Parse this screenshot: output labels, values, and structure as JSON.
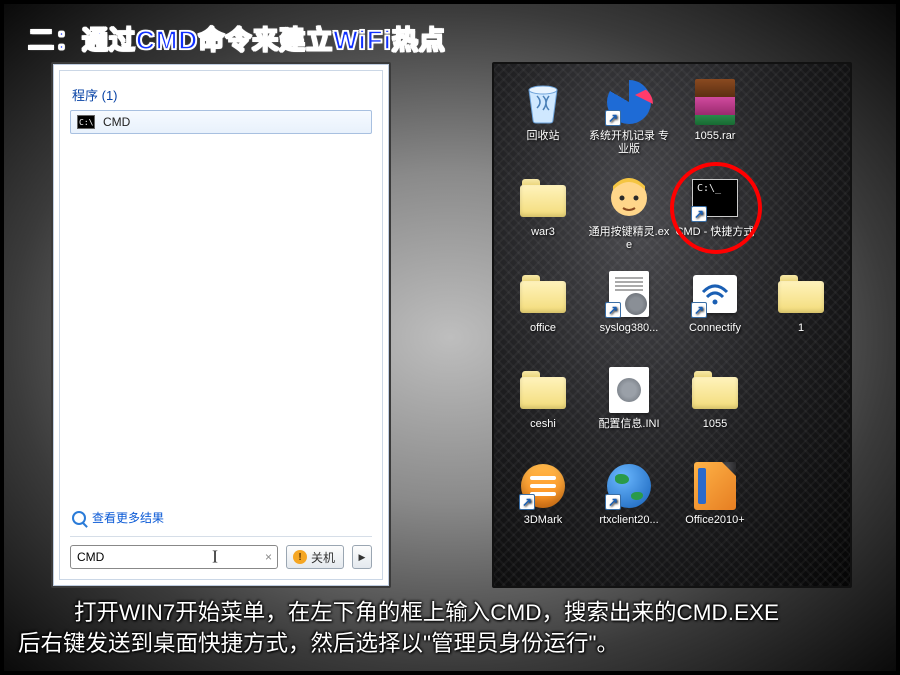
{
  "title": "二：通过CMD命令来建立WiFi热点",
  "start_menu": {
    "programs_header": "程序 (1)",
    "program_item": {
      "label": "CMD"
    },
    "more_results": "查看更多结果",
    "search_value": "CMD",
    "shutdown_label": "关机"
  },
  "desktop": {
    "icons": [
      {
        "id": "recycle-bin",
        "label": "回收站",
        "shortcut": false
      },
      {
        "id": "boot-recorder",
        "label": "系统开机记录 专业版",
        "shortcut": true
      },
      {
        "id": "rar-file",
        "label": "1055.rar",
        "shortcut": false
      },
      null,
      {
        "id": "war3-folder",
        "label": "war3",
        "shortcut": false
      },
      {
        "id": "keypress-wizard",
        "label": "通用按键精灵.exe",
        "shortcut": false
      },
      {
        "id": "cmd-shortcut",
        "label": "CMD - 快捷方式",
        "shortcut": true
      },
      null,
      {
        "id": "office-folder",
        "label": "office",
        "shortcut": false
      },
      {
        "id": "syslog",
        "label": "syslog380...",
        "shortcut": true
      },
      {
        "id": "connectify",
        "label": "Connectify",
        "shortcut": true
      },
      {
        "id": "folder-1",
        "label": "1",
        "shortcut": false
      },
      {
        "id": "ceshi-folder",
        "label": "ceshi",
        "shortcut": false
      },
      {
        "id": "config-ini",
        "label": "配置信息.INI",
        "shortcut": false
      },
      {
        "id": "folder-1055",
        "label": "1055",
        "shortcut": false
      },
      null,
      {
        "id": "3dmark",
        "label": "3DMark",
        "shortcut": true
      },
      {
        "id": "rtxclient",
        "label": "rtxclient20...",
        "shortcut": true
      },
      {
        "id": "office2010",
        "label": "Office2010+",
        "shortcut": false
      },
      null
    ]
  },
  "caption_line1": "打开WIN7开始菜单，在左下角的框上输入CMD，搜索出来的CMD.EXE",
  "caption_line2": "后右键发送到桌面快捷方式，然后选择以\"管理员身份运行\"。"
}
